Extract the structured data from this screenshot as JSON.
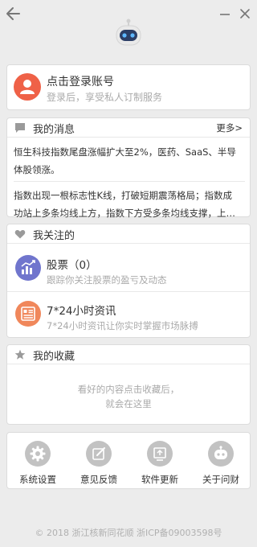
{
  "window": {
    "back_icon": "arrow-left-icon",
    "minimize_icon": "minimize-icon",
    "close_icon": "close-icon",
    "logo_icon": "robot-icon"
  },
  "login": {
    "title": "点击登录账号",
    "subtitle": "登录后，享受私人订制服务",
    "avatar_icon": "user-icon",
    "accent": "#ef6147"
  },
  "messages": {
    "title": "我的消息",
    "more": "更多>",
    "items": [
      {
        "line1": "恒生科技指数尾盘涨幅扩大至2%，医药、SaaS、半导",
        "line2": "体股领涨。"
      },
      {
        "line1": "指数出现一根标志性K线，打破短期震荡格局；指数成",
        "line2": "功站上多条均线上方，指数下方受多条均线支撑，上…"
      }
    ]
  },
  "follow": {
    "title": "我关注的",
    "items": [
      {
        "title": "股票（0）",
        "subtitle": "跟踪你关注股票的盈亏及动态",
        "icon": "stock-chart-icon",
        "color": "#7075cd"
      },
      {
        "title": "7*24小时资讯",
        "subtitle": "7*24小时资讯让你实时掌握市场脉搏",
        "icon": "news-icon",
        "color": "#f0875b"
      }
    ]
  },
  "favorites": {
    "title": "我的收藏",
    "empty_line1": "看好的内容点击收藏后，",
    "empty_line2": "就会在这里"
  },
  "tools": [
    {
      "label": "系统设置",
      "icon": "gear-icon"
    },
    {
      "label": "意见反馈",
      "icon": "edit-icon"
    },
    {
      "label": "软件更新",
      "icon": "update-icon"
    },
    {
      "label": "关于问财",
      "icon": "robot-icon"
    }
  ],
  "footer": "© 2018 浙江核新同花顺 浙ICP备09003598号"
}
